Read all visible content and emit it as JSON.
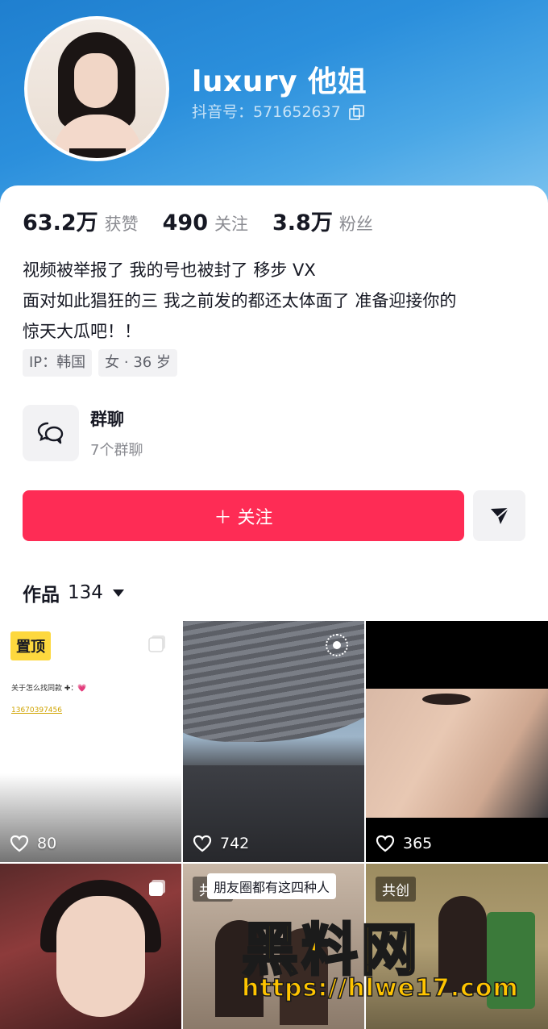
{
  "profile": {
    "username": "luxury 他姐",
    "douyin_id": "抖音号：571652637"
  },
  "stats": [
    {
      "value": "63.2万",
      "label": "获赞"
    },
    {
      "value": "490",
      "label": "关注"
    },
    {
      "value": "3.8万",
      "label": "粉丝"
    }
  ],
  "bio": [
    "视频被举报了 我的号也被封了  移步 VX",
    "面对如此猖狂的三 我之前发的都还太体面了 准备迎接你的",
    "惊天大瓜吧！！"
  ],
  "tags": [
    "IP：韩国",
    "女 · 36 岁"
  ],
  "group": {
    "title": "群聊",
    "subtitle": "7个群聊"
  },
  "follow_button": "＋ 关注",
  "works": {
    "label": "作品",
    "count": "134"
  },
  "grid": {
    "tile1": {
      "badge": "置顶",
      "line1": "关于怎么找同款 ✚：💗",
      "line2": "13670397456",
      "likes": "80"
    },
    "tile2": {
      "likes": "742"
    },
    "tile3": {
      "likes": "365"
    },
    "tile5": {
      "tag": "共创",
      "title": "朋友圈都有这四种人"
    },
    "tile6": {
      "tag": "共创"
    }
  },
  "watermark": {
    "brand": "黑料网",
    "url": "https://hlwe17.com"
  },
  "colors": {
    "header_gradient_start": "#1f7fcf",
    "follow_button": "#fe2c55",
    "pin_badge": "#fdd83e"
  }
}
